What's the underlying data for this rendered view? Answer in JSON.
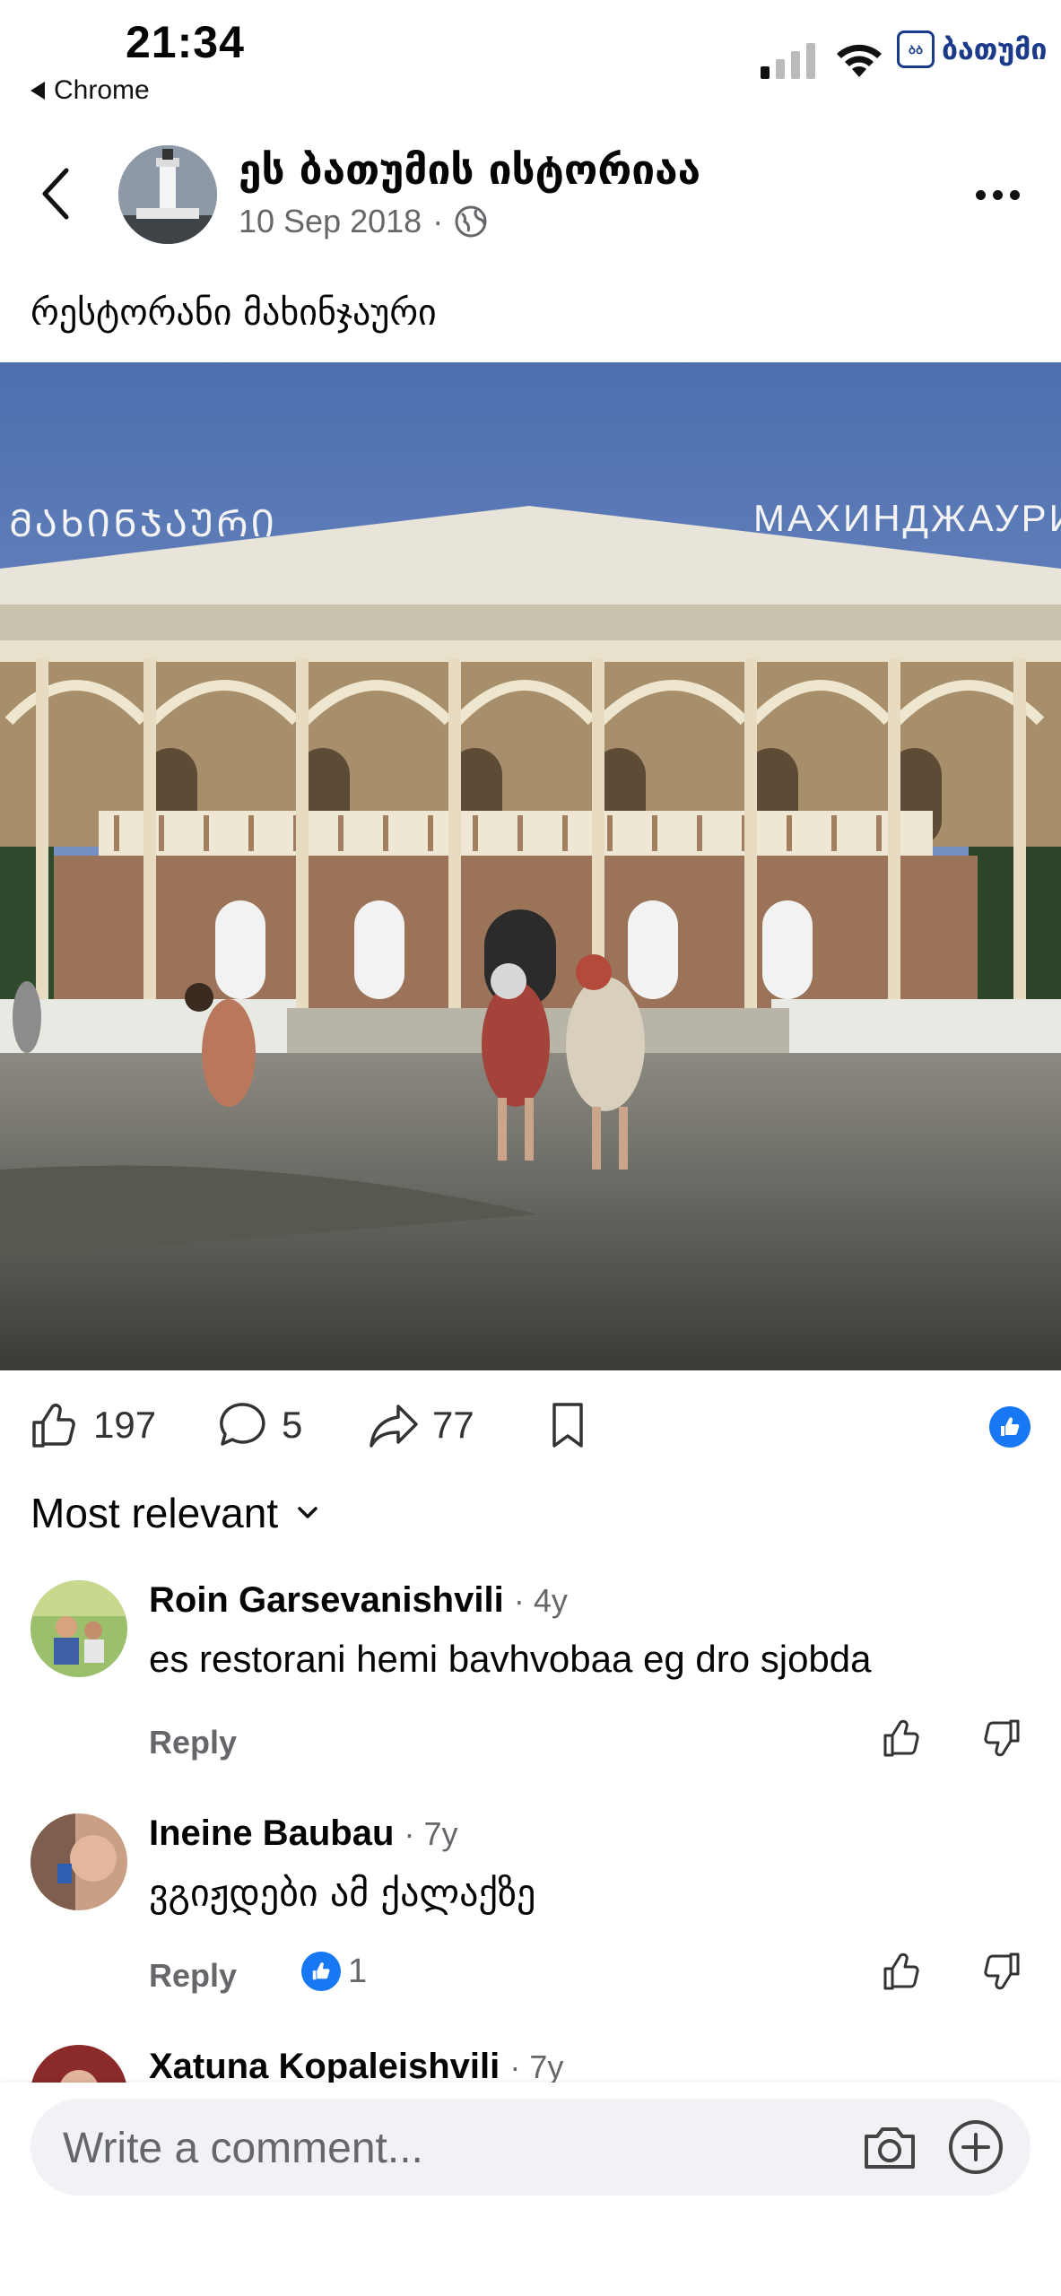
{
  "status_bar": {
    "time": "21:34",
    "back_app": "Chrome",
    "carrier_logo_text": "ბათუმი"
  },
  "post": {
    "page_name": "ეს ბათუმის ისტორიაა",
    "date": "10 Sep 2018",
    "meta_separator": "·",
    "caption": "რესტორანი მახინჯაური"
  },
  "photo_signs": {
    "left_sign": "ᲛᲐᲮᲘᲜᲯᲐᲣᲠᲘ",
    "right_sign": "МАХИНДЖАУРИ"
  },
  "actions": {
    "likes": "197",
    "comments": "5",
    "shares": "77"
  },
  "sort": {
    "label": "Most relevant"
  },
  "comments": [
    {
      "author": "Roin Garsevanishvili",
      "age": "· 4y",
      "text": "es restorani hemi bavhvobaa eg dro sjobda",
      "reply": "Reply",
      "reactions": ""
    },
    {
      "author": "Ineine Baubau",
      "age": "· 7y",
      "text": "ვგიჟდები ამ ქალაქზე",
      "reply": "Reply",
      "reactions": "1"
    },
    {
      "author": "Xatuna Kopaleishvili",
      "age": "· 7y",
      "text": "",
      "reply": "",
      "reactions": ""
    }
  ],
  "composer": {
    "placeholder": "Write a comment..."
  },
  "colors": {
    "accent": "#1877f2",
    "muted": "#65676b",
    "composer_bg": "#f0f2f5"
  }
}
